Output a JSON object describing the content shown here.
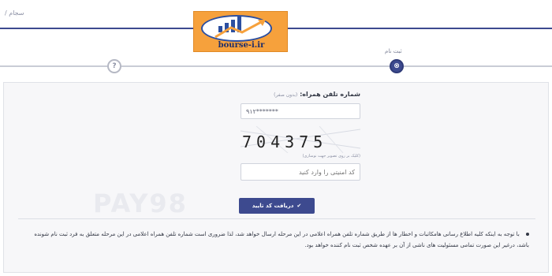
{
  "header": {
    "breadcrumb": "سجام /"
  },
  "logo": {
    "text": "bourse-i.ir",
    "brand_color": "#f6a13c"
  },
  "steps": {
    "active_label": "ثبت نام",
    "pending_symbol": "?",
    "active_symbol": "⊗"
  },
  "form": {
    "phone_label": "شماره تلفن همراه:",
    "phone_hint": "(بدون صفر)",
    "phone_value": "۹۱۲*******",
    "captcha_text": "704375",
    "captcha_hint": "(کلیک بر روی تصویر جهت نوسازی)",
    "code_placeholder": "کد امنیتی را وارد کنید",
    "submit_label": "دریافت کد تایید"
  },
  "watermark": "PAY98",
  "notice": {
    "text": "با توجه به اینکه کلیه اطلاع رسانی هامکاتبات و اخطار ها از طریق شماره تلفن همراه اعلامی در این مرحله ارسال خواهد شد، لذا ضروری است شماره تلفن همراه اعلامی در این مرحله متعلق به فرد ثبت نام شونده باشد، درغیر این صورت تمامی مسئولیت های ناشی از آن بر عهده شخص ثبت نام کننده خواهد بود."
  },
  "colors": {
    "primary": "#3d4a8f",
    "panel_bg": "#f7f7f9"
  }
}
